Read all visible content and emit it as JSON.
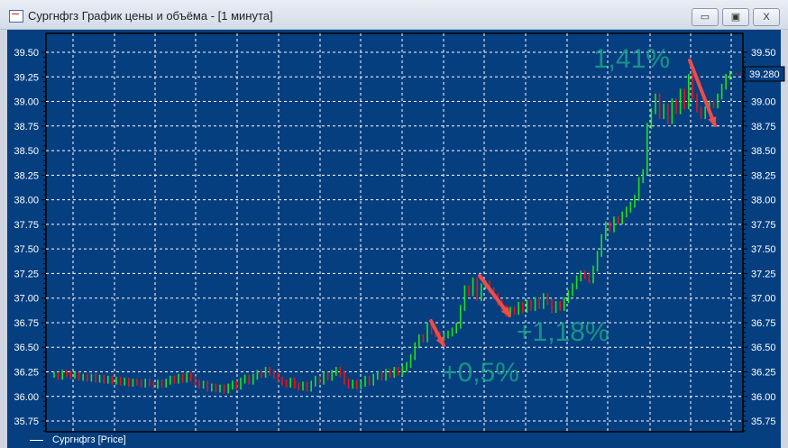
{
  "window": {
    "title": "Сургнфгз График цены и объёма - [1 минута]",
    "minimize": "▭",
    "restore": "▣",
    "close": "X"
  },
  "legend": {
    "label": "Сургнфгз [Price]"
  },
  "annotations": {
    "a1": "+0,5%",
    "a2": "+1,18%",
    "a3": "1,41%"
  },
  "colors": {
    "background": "#063f80",
    "up": "#22e01a",
    "down": "#e81414",
    "arrow": "#ef4b4b",
    "annotation": "#1aa389"
  },
  "chart_data": {
    "type": "bar",
    "title": "Сургнфгз График цены и объёма",
    "ylim": [
      35.65,
      39.7
    ],
    "yticks": [
      "35.75",
      "36.00",
      "36.25",
      "36.50",
      "36.75",
      "37.00",
      "37.25",
      "37.50",
      "37.75",
      "38.00",
      "38.25",
      "38.50",
      "38.75",
      "39.00",
      "39.25",
      "39.50"
    ],
    "last_price": "39.280",
    "closes": [
      36.22,
      36.2,
      36.24,
      36.23,
      36.21,
      36.22,
      36.19,
      36.2,
      36.18,
      36.2,
      36.17,
      36.19,
      36.16,
      36.18,
      36.15,
      36.17,
      36.14,
      36.16,
      36.13,
      36.15,
      36.14,
      36.12,
      36.15,
      36.13,
      36.11,
      36.14,
      36.12,
      36.15,
      36.18,
      36.16,
      36.2,
      36.17,
      36.22,
      36.18,
      36.14,
      36.11,
      36.13,
      36.08,
      36.1,
      36.07,
      36.09,
      36.06,
      36.1,
      36.13,
      36.1,
      36.16,
      36.19,
      36.15,
      36.2,
      36.24,
      36.22,
      36.27,
      36.24,
      36.21,
      36.17,
      36.14,
      36.12,
      36.16,
      36.11,
      36.09,
      36.12,
      36.08,
      36.13,
      36.18,
      36.15,
      36.22,
      36.19,
      36.24,
      36.27,
      36.23,
      36.15,
      36.11,
      36.14,
      36.1,
      36.13,
      36.18,
      36.14,
      36.2,
      36.23,
      36.19,
      36.25,
      36.22,
      36.27,
      36.24,
      36.28,
      36.32,
      36.4,
      36.52,
      36.6,
      36.58,
      36.72,
      36.66,
      36.63,
      36.6,
      36.62,
      36.64,
      36.67,
      36.72,
      36.9,
      37.1,
      37.05,
      37.18,
      37.0,
      37.12,
      37.15,
      37.08,
      37.02,
      36.95,
      36.9,
      36.84,
      36.88,
      36.86,
      36.93,
      36.88,
      36.95,
      36.9,
      36.98,
      36.92,
      37.02,
      36.96,
      36.88,
      36.94,
      36.9,
      36.98,
      37.05,
      37.12,
      37.2,
      37.25,
      37.22,
      37.18,
      37.3,
      37.45,
      37.62,
      37.75,
      37.7,
      37.8,
      37.78,
      37.85,
      37.9,
      37.95,
      38.02,
      38.2,
      38.28,
      38.75,
      38.9,
      39.05,
      38.85,
      38.95,
      38.8,
      39.0,
      38.9,
      39.1,
      38.95,
      39.25,
      39.05,
      38.92,
      38.85,
      38.92,
      38.98,
      38.96,
      39.05,
      39.15,
      39.25,
      39.28
    ]
  }
}
